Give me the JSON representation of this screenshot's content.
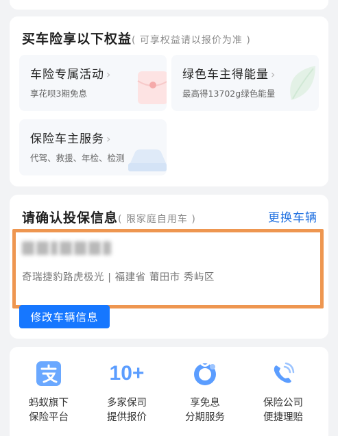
{
  "benefits_section": {
    "title": "买车险享以下权益",
    "subtitle": "( 可享权益请以报价为准 )",
    "items": [
      {
        "title": "车险专属活动",
        "desc": "享花呗3期免息"
      },
      {
        "title": "绿色车主得能量",
        "desc": "最高得13702g绿色能量"
      },
      {
        "title": "保险车主服务",
        "desc": "代驾、救援、年检、检测"
      }
    ]
  },
  "confirm_section": {
    "title": "请确认投保信息",
    "subtitle": "( 限家庭自用车 )",
    "change_vehicle_label": "更换车辆",
    "vehicle_desc": "奇瑞捷豹路虎极光 | 福建省 莆田市 秀屿区",
    "edit_button_label": "修改车辆信息"
  },
  "features": [
    {
      "icon": "alipay-icon",
      "line1": "蚂蚁旗下",
      "line2": "保险平台"
    },
    {
      "icon": "ten-plus-icon",
      "icon_text": "10+",
      "line1": "多家保司",
      "line2": "提供报价"
    },
    {
      "icon": "installment-icon",
      "line1": "享免息",
      "line2": "分期服务"
    },
    {
      "icon": "phone-service-icon",
      "line1": "保险公司",
      "line2": "便捷理赔"
    }
  ],
  "colors": {
    "accent_blue": "#1677ff",
    "link_blue": "#1e6fe0",
    "highlight_orange": "#ee9650",
    "icon_blue": "#3d8bff"
  }
}
